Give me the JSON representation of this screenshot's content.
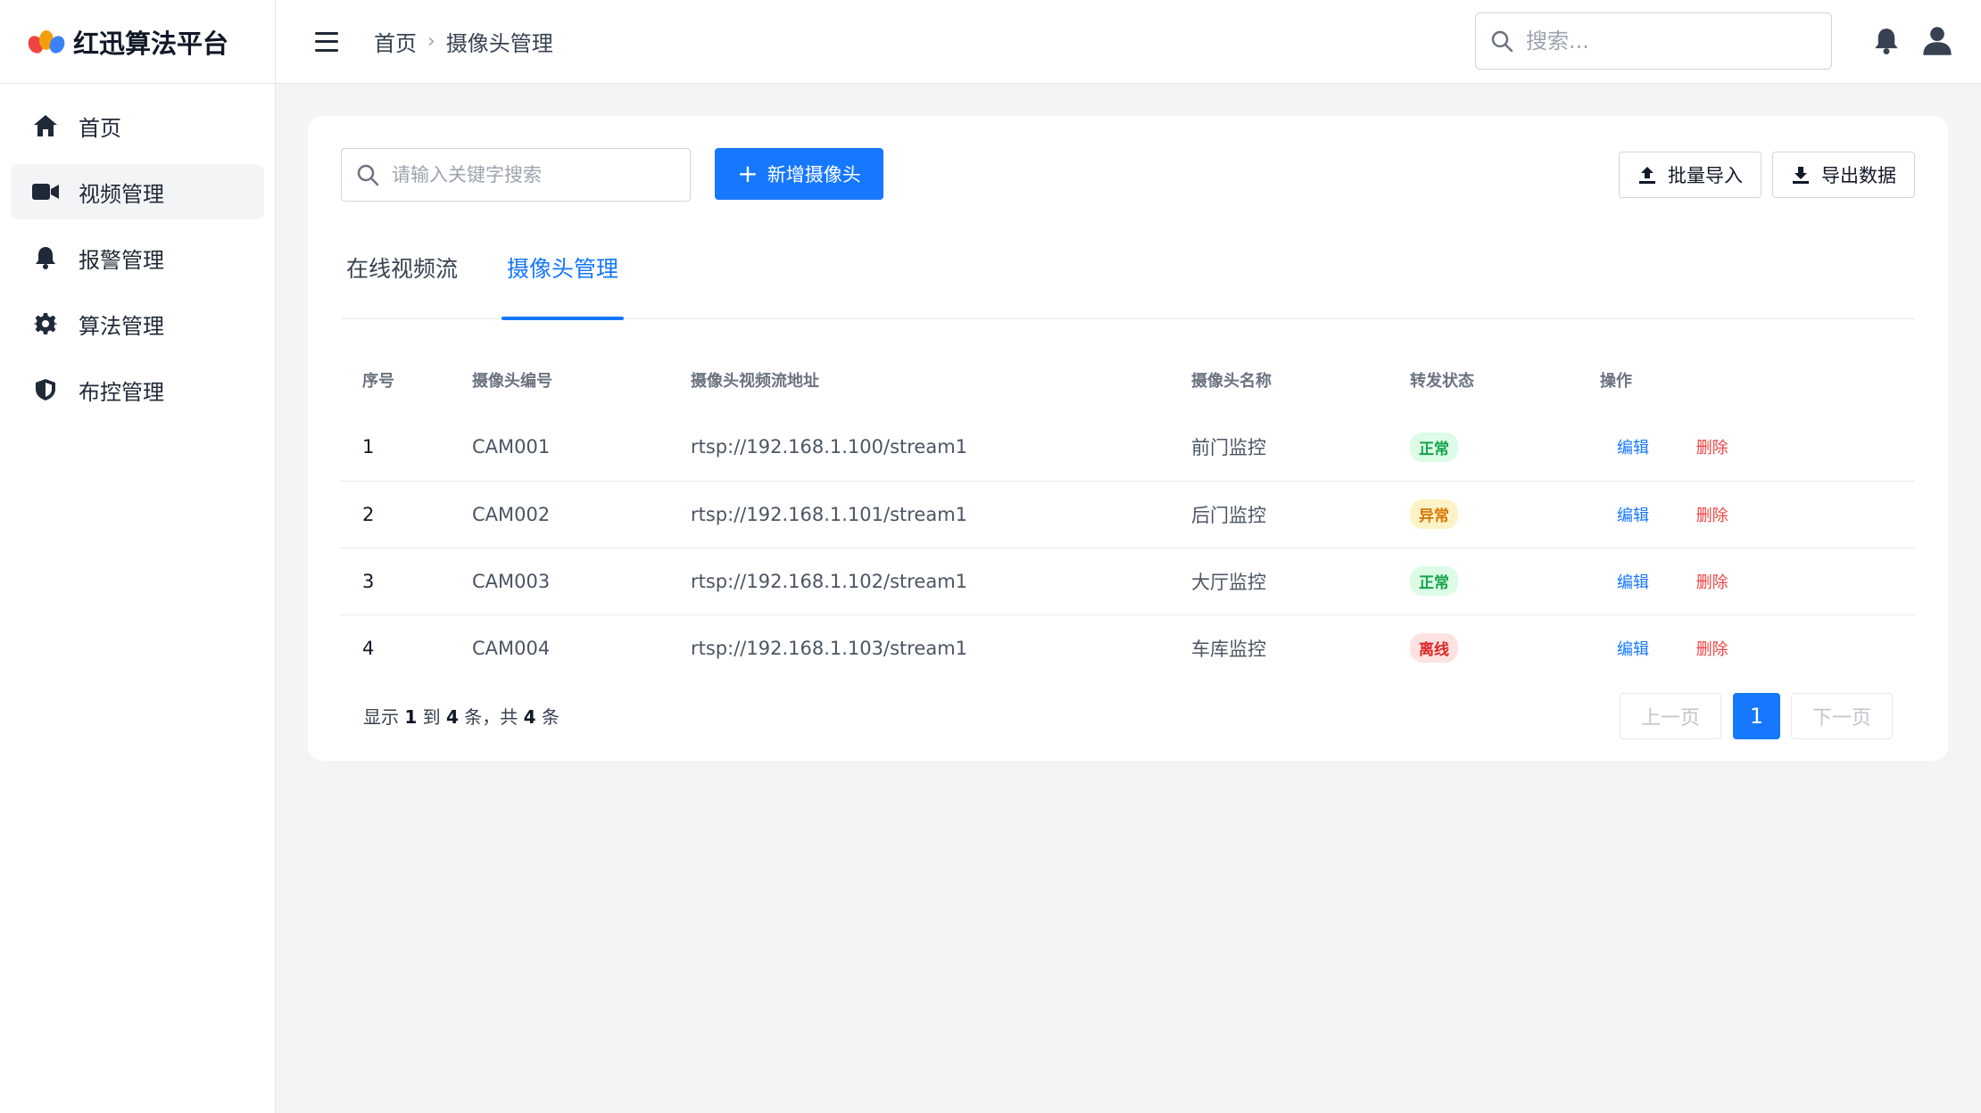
{
  "app": {
    "title": "红迅算法平台"
  },
  "sidebar": {
    "items": [
      {
        "label": "首页",
        "icon": "home-icon"
      },
      {
        "label": "视频管理",
        "icon": "video-camera-icon",
        "active": true
      },
      {
        "label": "报警管理",
        "icon": "bell-icon"
      },
      {
        "label": "算法管理",
        "icon": "gear-icon"
      },
      {
        "label": "布控管理",
        "icon": "shield-icon"
      }
    ]
  },
  "header": {
    "breadcrumb": [
      "首页",
      "摄像头管理"
    ],
    "search_placeholder": "搜索..."
  },
  "toolbar": {
    "search_placeholder": "请输入关键字搜索",
    "add_label": "新增摄像头",
    "import_label": "批量导入",
    "export_label": "导出数据"
  },
  "tabs": [
    {
      "label": "在线视频流",
      "active": false
    },
    {
      "label": "摄像头管理",
      "active": true
    }
  ],
  "table": {
    "columns": [
      "序号",
      "摄像头编号",
      "摄像头视频流地址",
      "摄像头名称",
      "转发状态",
      "操作"
    ],
    "rows": [
      {
        "no": "1",
        "id": "CAM001",
        "url": "rtsp://192.168.1.100/stream1",
        "name": "前门监控",
        "status": "正常"
      },
      {
        "no": "2",
        "id": "CAM002",
        "url": "rtsp://192.168.1.101/stream1",
        "name": "后门监控",
        "status": "异常"
      },
      {
        "no": "3",
        "id": "CAM003",
        "url": "rtsp://192.168.1.102/stream1",
        "name": "大厅监控",
        "status": "正常"
      },
      {
        "no": "4",
        "id": "CAM004",
        "url": "rtsp://192.168.1.103/stream1",
        "name": "车库监控",
        "status": "离线"
      }
    ],
    "edit_label": "编辑",
    "delete_label": "删除"
  },
  "pagination": {
    "info_prefix": "显示",
    "from": "1",
    "to_word": "到",
    "to": "4",
    "tiao1": "条，共",
    "total": "4",
    "tiao2": "条",
    "prev_label": "上一页",
    "current_page": "1",
    "next_label": "下一页"
  },
  "colors": {
    "primary": "#1677ff",
    "ok": "#16a34a",
    "warn": "#d97706",
    "off": "#dc2626"
  }
}
